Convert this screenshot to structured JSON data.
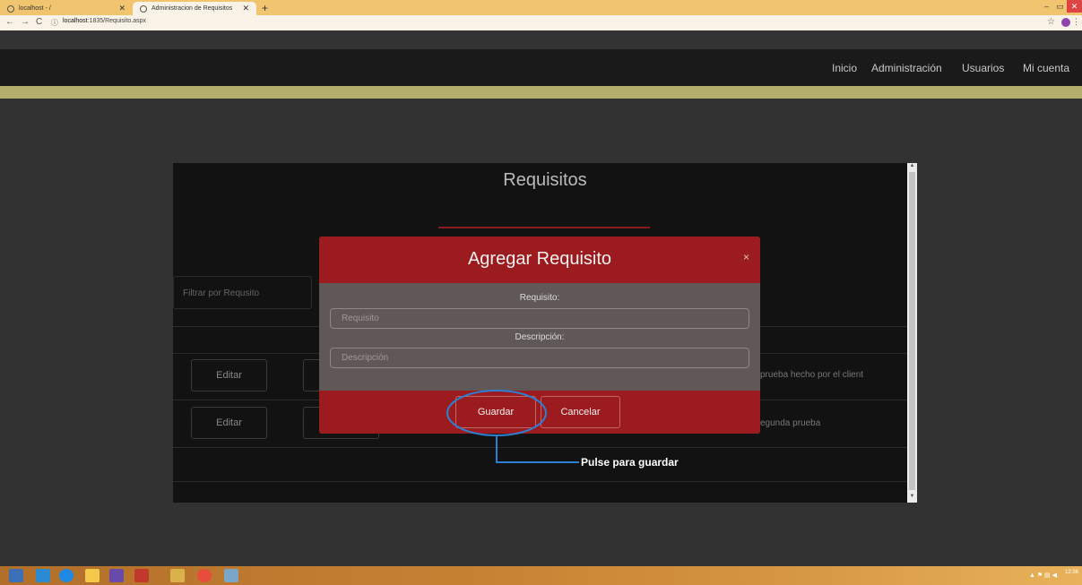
{
  "browser": {
    "tabs": [
      {
        "label": "localhost - /"
      },
      {
        "label": "Administracion de Requisitos"
      }
    ],
    "url_host": "localhost",
    "url_path": ":1835/Requisito.aspx"
  },
  "site_nav": {
    "items": [
      "Inicio",
      "Administración",
      "Usuarios",
      "Mi cuenta"
    ]
  },
  "page": {
    "title": "Requisitos",
    "filter_placeholder": "Filtrar por Requsito",
    "rows": [
      {
        "edit_label": "Editar",
        "description": "prueba hecho por el client"
      },
      {
        "edit_label": "Editar",
        "description": "egunda prueba"
      }
    ]
  },
  "modal": {
    "title": "Agregar Requisito",
    "close_symbol": "×",
    "requisito_label": "Requisito:",
    "requisito_placeholder": "Requisito",
    "descripcion_label": "Descripción:",
    "descripcion_placeholder": "Descripción",
    "save_label": "Guardar",
    "cancel_label": "Cancelar"
  },
  "annotation": {
    "text": "Pulse para guardar",
    "color": "#2f7fd0"
  },
  "taskbar": {
    "time": "12:36"
  },
  "colors": {
    "modal_red": "#9b1b1f",
    "modal_body": "#5f5857",
    "nav_bg": "#1a1a1a",
    "accent_band": "#b3ae6c",
    "chrome": "#f1c56f"
  }
}
